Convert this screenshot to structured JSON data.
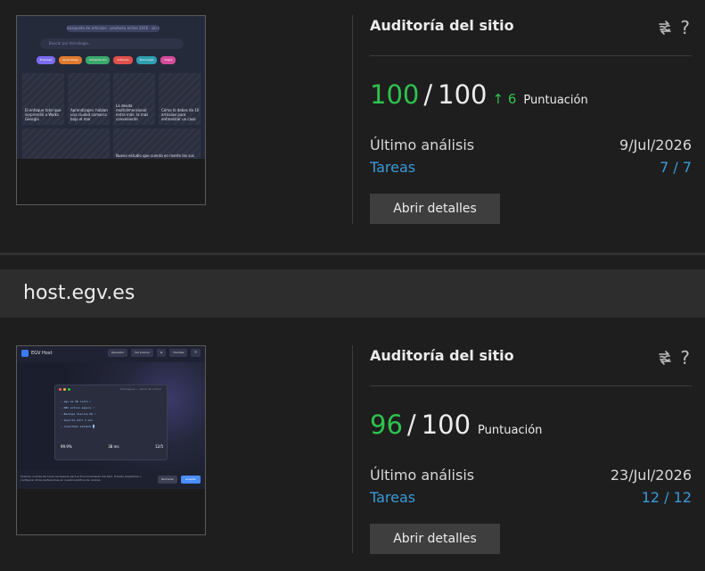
{
  "cards": [
    {
      "panel_title": "Auditoría del sitio",
      "help": "?",
      "score": "100",
      "score_sep": "/",
      "score_max": "100",
      "score_delta": "↑ 6",
      "score_label": "Puntuación",
      "last_label": "Último análisis",
      "last_value": "9/Jul/2026",
      "tasks_label": "Tareas",
      "tasks_value": "7 / 7",
      "button": "Abrir detalles",
      "thumbnail": {
        "top": "Búsqueda de artículos · producto online 2026 · sin recomendados",
        "search": "Buscar por tecnología...",
        "chips": [
          "Empresa",
          "Aprendizaje",
          "Alimentación",
          "Artículos",
          "Tecnología",
          "Viajes"
        ],
        "tiles": [
          "El enfoque total que sorprendió a Walks Georgia",
          "Aprendizajes: hablan una ciudad comarca bajo el mar",
          "La deuda multidimensional entra más: la más conveniente",
          "Cómo lo debes de 10 artículos para entrevistar un caso"
        ],
        "tile_bottom": "Nuevo estudio que cuenta en mente las sus"
      }
    },
    {
      "panel_title": "Auditoría del sitio",
      "help": "?",
      "score": "96",
      "score_sep": "/",
      "score_max": "100",
      "score_label": "Puntuación",
      "last_label": "Último análisis",
      "last_value": "23/Jul/2026",
      "tasks_label": "Tareas",
      "tasks_value": "12 / 12",
      "button": "Abrir detalles",
      "thumbnail": {
        "brand": "EGV Host",
        "nav": [
          "Operador",
          "Ver precios",
          "⊕",
          "Clientes",
          "☰"
        ],
        "window_title": "host.egv.es — panel de control",
        "code": [
          "› egv.es  OK  listo  ✓",
          "› DNS  activo  seguro  ✓",
          "› Backups  diarios  OK  ✓",
          "› Soporte  24/7  3 min",
          "› conectado  estable  █"
        ],
        "stats": [
          "99.9%",
          "38 ms",
          "12/5"
        ],
        "cookie_text": "Usamos cookies técnicas necesarias para el funcionamiento del sitio. Puedes aceptarlas o configurar otras preferencias en nuestra política de cookies.",
        "cookie_reject": "Rechazar",
        "cookie_accept": "Aceptar"
      }
    }
  ],
  "site_header": "host.egv.es",
  "colors": {
    "bg": "#1e1e1e",
    "score_green": "#2ec24e",
    "link_blue": "#3a9ad9",
    "button_bg": "#3e3e3e",
    "header_bg": "#2d2d2d"
  }
}
